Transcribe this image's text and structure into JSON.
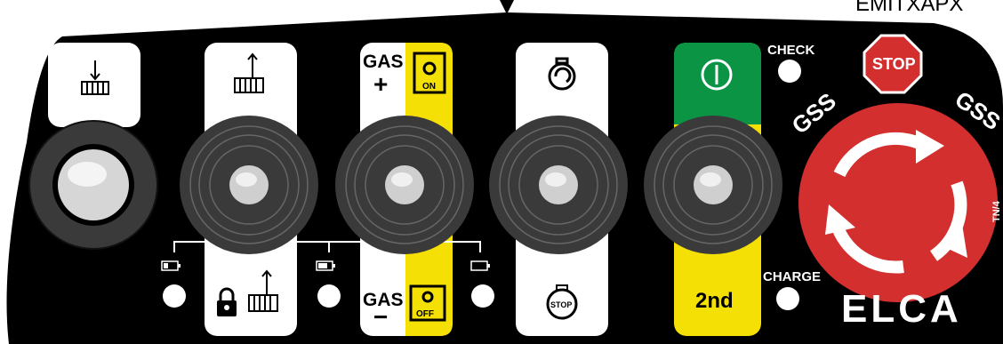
{
  "model_code": "EMITXAPX",
  "colors": {
    "panel": "#000000",
    "strip_white": "#ffffff",
    "strip_yellow": "#f4e004",
    "strip_green": "#0b9444",
    "stop_red": "#d32f2f",
    "knob_gray": "#3a3a3a"
  },
  "buttons": [
    {
      "id": "winch-down",
      "icon": "winch-down-icon",
      "bottom_icon": ""
    },
    {
      "id": "winch-up",
      "icon": "winch-up-icon",
      "bottom_icon": "lock-winch-up-icon",
      "led_icon": "battery-low-icon"
    },
    {
      "id": "gas",
      "top_label_1": "GAS",
      "top_label_2": "+",
      "top_badge": "ON",
      "bottom_label_1": "GAS",
      "bottom_label_2": "−",
      "bottom_badge": "OFF",
      "led_icon": "battery-mid-icon"
    },
    {
      "id": "engine",
      "icon": "engine-start-icon",
      "bottom_label": "STOP",
      "led_icon": "battery-full-icon"
    },
    {
      "id": "power",
      "icon": "power-icon",
      "bottom_label": "2nd"
    }
  ],
  "indicators": {
    "check_label": "CHECK",
    "charge_label": "CHARGE"
  },
  "emergency_stop": {
    "sign_text": "STOP",
    "ring_text_left": "GSS",
    "ring_text_right": "GSS"
  },
  "brand": "ELCA",
  "side_mark": "TN/4"
}
